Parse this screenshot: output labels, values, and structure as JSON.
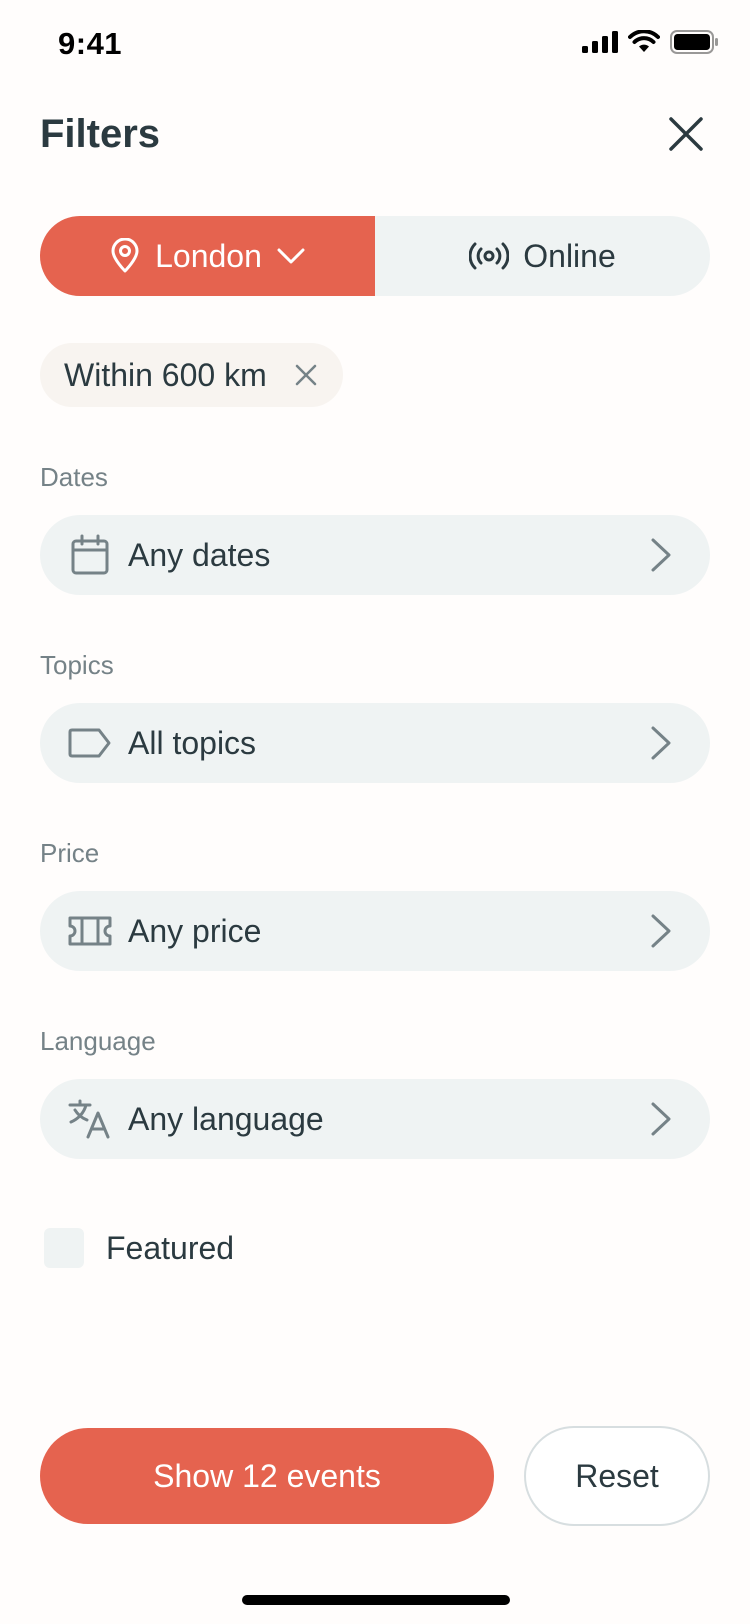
{
  "status": {
    "time": "9:41"
  },
  "header": {
    "title": "Filters"
  },
  "location_toggle": {
    "city": "London",
    "online": "Online"
  },
  "distance_chip": {
    "label": "Within 600 km"
  },
  "filters": {
    "dates": {
      "section": "Dates",
      "value": "Any dates"
    },
    "topics": {
      "section": "Topics",
      "value": "All topics"
    },
    "price": {
      "section": "Price",
      "value": "Any price"
    },
    "language": {
      "section": "Language",
      "value": "Any language"
    }
  },
  "featured": {
    "label": "Featured",
    "checked": false
  },
  "actions": {
    "show": "Show 12 events",
    "reset": "Reset"
  },
  "colors": {
    "accent": "#e5634f",
    "row_bg": "#eff3f3",
    "text": "#2b3a40",
    "muted": "#758287"
  }
}
